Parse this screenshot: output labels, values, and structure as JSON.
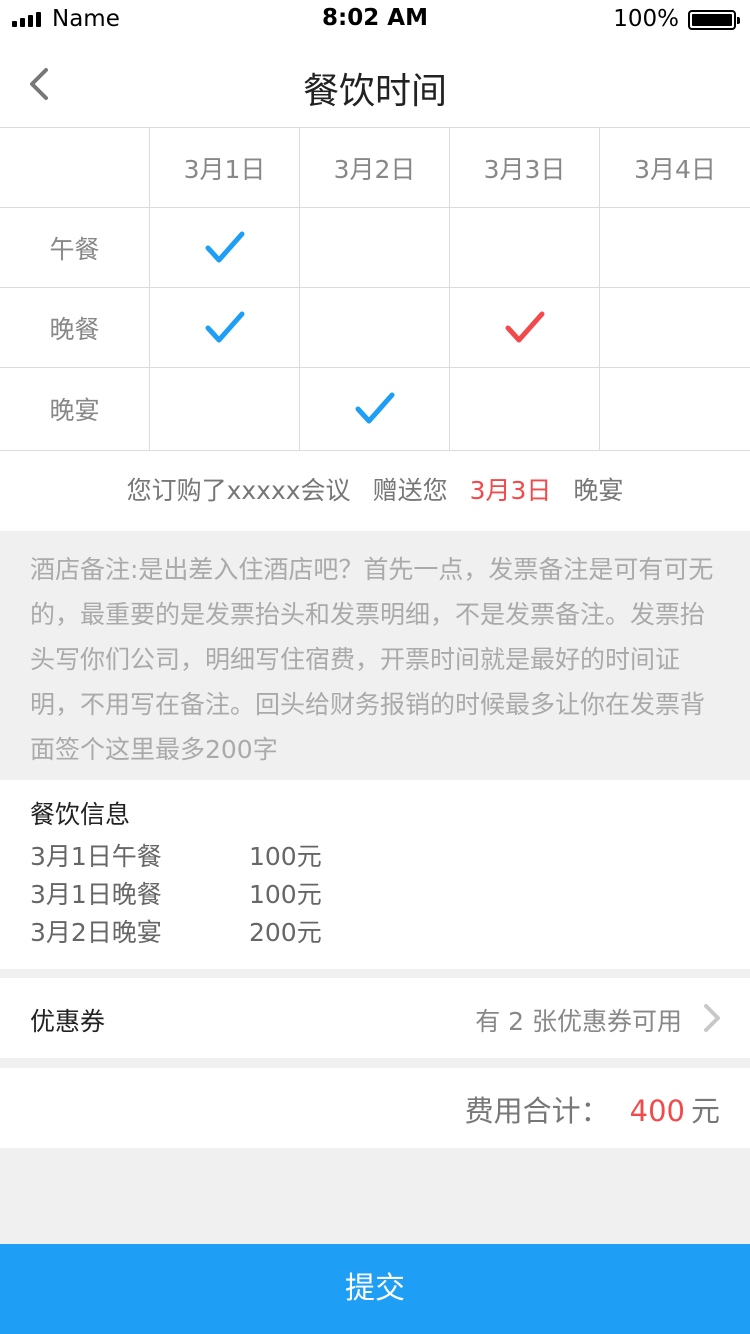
{
  "status_bar": {
    "carrier": "Name",
    "time": "8:02 AM",
    "battery": "100%"
  },
  "nav": {
    "title": "餐饮时间",
    "back_icon": "chevron-left-icon"
  },
  "table": {
    "columns": [
      "3月1日",
      "3月2日",
      "3月3日",
      "3月4日"
    ],
    "rows": [
      {
        "label": "午餐",
        "cells": [
          "blue",
          "",
          "",
          ""
        ]
      },
      {
        "label": "晚餐",
        "cells": [
          "blue",
          "",
          "red",
          ""
        ]
      },
      {
        "label": "晚宴",
        "cells": [
          "",
          "blue",
          "",
          ""
        ]
      }
    ],
    "check_icon": "checkmark-icon"
  },
  "promo": {
    "text_1": "您订购了xxxxx会议",
    "text_2": "赠送您",
    "date": "3月3日",
    "meal": "晚宴"
  },
  "remark": "酒店备注:是出差入住酒店吧？首先一点，发票备注是可有可无的，最重要的是发票抬头和发票明细，不是发票备注。发票抬头写你们公司，明细写住宿费，开票时间就是最好的时间证明，不用写在备注。回头给财务报销的时候最多让你在发票背面签个这里最多200字",
  "info": {
    "title": "餐饮信息",
    "items": [
      {
        "label": "3月1日午餐",
        "price": "100元"
      },
      {
        "label": "3月1日晚餐",
        "price": "100元"
      },
      {
        "label": "3月2日晚宴",
        "price": "200元"
      }
    ]
  },
  "coupon": {
    "label": "优惠券",
    "value": "有 2 张优惠券可用",
    "arrow_icon": "chevron-right-icon"
  },
  "total": {
    "label": "费用合计：",
    "amount": "400",
    "unit": "元"
  },
  "submit": {
    "label": "提交"
  },
  "colors": {
    "accent": "#1e9ef4",
    "highlight": "#f24a4a",
    "check_blue": "#1e9ef4",
    "check_red": "#f24a4a"
  }
}
